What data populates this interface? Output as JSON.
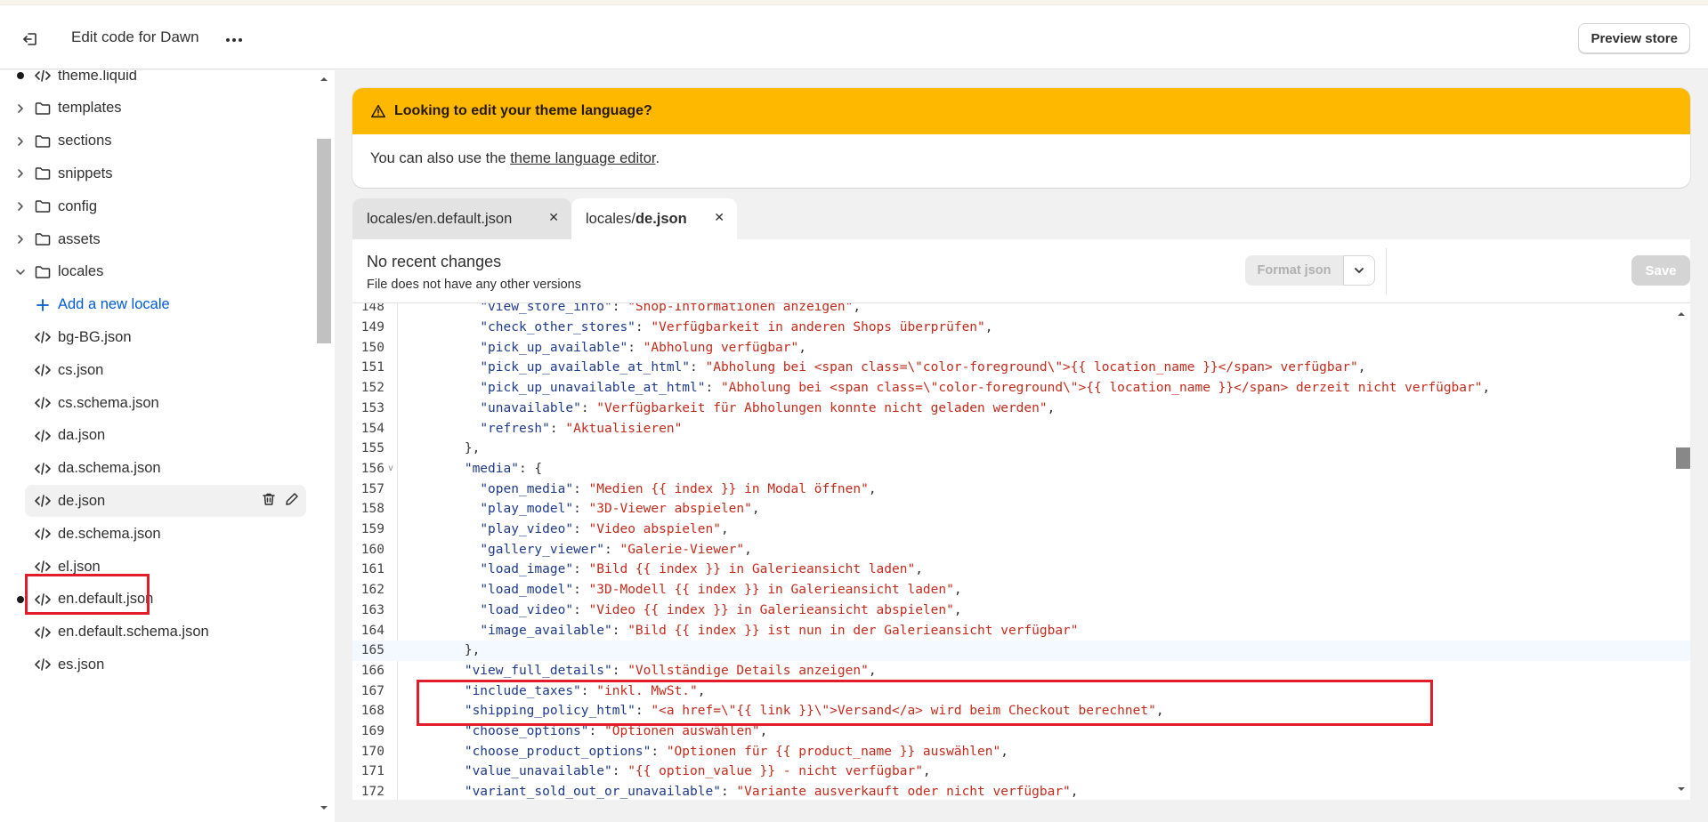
{
  "header": {
    "title": "Edit code for Dawn",
    "preview_label": "Preview store"
  },
  "sidebar": {
    "items": [
      {
        "label": "theme.liquid",
        "kind": "file",
        "dot": true
      },
      {
        "label": "templates",
        "kind": "folder"
      },
      {
        "label": "sections",
        "kind": "folder"
      },
      {
        "label": "snippets",
        "kind": "folder"
      },
      {
        "label": "config",
        "kind": "folder"
      },
      {
        "label": "assets",
        "kind": "folder"
      },
      {
        "label": "locales",
        "kind": "folder-open"
      },
      {
        "label": "Add a new locale",
        "kind": "add"
      },
      {
        "label": "bg-BG.json",
        "kind": "file"
      },
      {
        "label": "cs.json",
        "kind": "file"
      },
      {
        "label": "cs.schema.json",
        "kind": "file"
      },
      {
        "label": "da.json",
        "kind": "file"
      },
      {
        "label": "da.schema.json",
        "kind": "file"
      },
      {
        "label": "de.json",
        "kind": "file",
        "selected": true
      },
      {
        "label": "de.schema.json",
        "kind": "file"
      },
      {
        "label": "el.json",
        "kind": "file"
      },
      {
        "label": "en.default.json",
        "kind": "file",
        "dot": true
      },
      {
        "label": "en.default.schema.json",
        "kind": "file"
      },
      {
        "label": "es.json",
        "kind": "file"
      }
    ]
  },
  "banner": {
    "title": "Looking to edit your theme language?",
    "body_prefix": "You can also use the ",
    "link": "theme language editor",
    "body_suffix": "."
  },
  "tabs": [
    {
      "prefix": "locales/en.default.json",
      "bold": "",
      "active": false
    },
    {
      "prefix": "locales/",
      "bold": "de.json",
      "active": true
    }
  ],
  "editor": {
    "status_title": "No recent changes",
    "status_sub": "File does not have any other versions",
    "format_label": "Format json",
    "save_label": "Save"
  },
  "code_lines": [
    {
      "n": "148",
      "t": [
        [
          "p",
          "          "
        ],
        [
          "k",
          "\"view_store_info\""
        ],
        [
          "p",
          ": "
        ],
        [
          "s",
          "\"Shop-Informationen anzeigen\""
        ],
        [
          "p",
          ","
        ]
      ]
    },
    {
      "n": "149",
      "t": [
        [
          "p",
          "          "
        ],
        [
          "k",
          "\"check_other_stores\""
        ],
        [
          "p",
          ": "
        ],
        [
          "s",
          "\"Verfügbarkeit in anderen Shops überprüfen\""
        ],
        [
          "p",
          ","
        ]
      ]
    },
    {
      "n": "150",
      "t": [
        [
          "p",
          "          "
        ],
        [
          "k",
          "\"pick_up_available\""
        ],
        [
          "p",
          ": "
        ],
        [
          "s",
          "\"Abholung verfügbar\""
        ],
        [
          "p",
          ","
        ]
      ]
    },
    {
      "n": "151",
      "t": [
        [
          "p",
          "          "
        ],
        [
          "k",
          "\"pick_up_available_at_html\""
        ],
        [
          "p",
          ": "
        ],
        [
          "s",
          "\"Abholung bei <span class=\\\"color-foreground\\\">{{ location_name }}</span> verfügbar\""
        ],
        [
          "p",
          ","
        ]
      ]
    },
    {
      "n": "152",
      "t": [
        [
          "p",
          "          "
        ],
        [
          "k",
          "\"pick_up_unavailable_at_html\""
        ],
        [
          "p",
          ": "
        ],
        [
          "s",
          "\"Abholung bei <span class=\\\"color-foreground\\\">{{ location_name }}</span> derzeit nicht verfügbar\""
        ],
        [
          "p",
          ","
        ]
      ]
    },
    {
      "n": "153",
      "t": [
        [
          "p",
          "          "
        ],
        [
          "k",
          "\"unavailable\""
        ],
        [
          "p",
          ": "
        ],
        [
          "s",
          "\"Verfügbarkeit für Abholungen konnte nicht geladen werden\""
        ],
        [
          "p",
          ","
        ]
      ]
    },
    {
      "n": "154",
      "t": [
        [
          "p",
          "          "
        ],
        [
          "k",
          "\"refresh\""
        ],
        [
          "p",
          ": "
        ],
        [
          "s",
          "\"Aktualisieren\""
        ]
      ]
    },
    {
      "n": "155",
      "t": [
        [
          "p",
          "        },"
        ]
      ]
    },
    {
      "n": "156",
      "fold": true,
      "t": [
        [
          "p",
          "        "
        ],
        [
          "k",
          "\"media\""
        ],
        [
          "p",
          ": {"
        ]
      ]
    },
    {
      "n": "157",
      "t": [
        [
          "p",
          "          "
        ],
        [
          "k",
          "\"open_media\""
        ],
        [
          "p",
          ": "
        ],
        [
          "s",
          "\"Medien {{ index }} in Modal öffnen\""
        ],
        [
          "p",
          ","
        ]
      ]
    },
    {
      "n": "158",
      "t": [
        [
          "p",
          "          "
        ],
        [
          "k",
          "\"play_model\""
        ],
        [
          "p",
          ": "
        ],
        [
          "s",
          "\"3D-Viewer abspielen\""
        ],
        [
          "p",
          ","
        ]
      ]
    },
    {
      "n": "159",
      "t": [
        [
          "p",
          "          "
        ],
        [
          "k",
          "\"play_video\""
        ],
        [
          "p",
          ": "
        ],
        [
          "s",
          "\"Video abspielen\""
        ],
        [
          "p",
          ","
        ]
      ]
    },
    {
      "n": "160",
      "t": [
        [
          "p",
          "          "
        ],
        [
          "k",
          "\"gallery_viewer\""
        ],
        [
          "p",
          ": "
        ],
        [
          "s",
          "\"Galerie-Viewer\""
        ],
        [
          "p",
          ","
        ]
      ]
    },
    {
      "n": "161",
      "t": [
        [
          "p",
          "          "
        ],
        [
          "k",
          "\"load_image\""
        ],
        [
          "p",
          ": "
        ],
        [
          "s",
          "\"Bild {{ index }} in Galerieansicht laden\""
        ],
        [
          "p",
          ","
        ]
      ]
    },
    {
      "n": "162",
      "t": [
        [
          "p",
          "          "
        ],
        [
          "k",
          "\"load_model\""
        ],
        [
          "p",
          ": "
        ],
        [
          "s",
          "\"3D-Modell {{ index }} in Galerieansicht laden\""
        ],
        [
          "p",
          ","
        ]
      ]
    },
    {
      "n": "163",
      "t": [
        [
          "p",
          "          "
        ],
        [
          "k",
          "\"load_video\""
        ],
        [
          "p",
          ": "
        ],
        [
          "s",
          "\"Video {{ index }} in Galerieansicht abspielen\""
        ],
        [
          "p",
          ","
        ]
      ]
    },
    {
      "n": "164",
      "t": [
        [
          "p",
          "          "
        ],
        [
          "k",
          "\"image_available\""
        ],
        [
          "p",
          ": "
        ],
        [
          "s",
          "\"Bild {{ index }} ist nun in der Galerieansicht verfügbar\""
        ]
      ]
    },
    {
      "n": "165",
      "hl": true,
      "t": [
        [
          "p",
          "        },"
        ]
      ]
    },
    {
      "n": "166",
      "t": [
        [
          "p",
          "        "
        ],
        [
          "k",
          "\"view_full_details\""
        ],
        [
          "p",
          ": "
        ],
        [
          "s",
          "\"Vollständige Details anzeigen\""
        ],
        [
          "p",
          ","
        ]
      ]
    },
    {
      "n": "167",
      "t": [
        [
          "p",
          "        "
        ],
        [
          "k",
          "\"include_taxes\""
        ],
        [
          "p",
          ": "
        ],
        [
          "s",
          "\"inkl. MwSt.\""
        ],
        [
          "p",
          ","
        ]
      ]
    },
    {
      "n": "168",
      "t": [
        [
          "p",
          "        "
        ],
        [
          "k",
          "\"shipping_policy_html\""
        ],
        [
          "p",
          ": "
        ],
        [
          "s",
          "\"<a href=\\\"{{ link }}\\\">Versand</a> wird beim Checkout berechnet\""
        ],
        [
          "p",
          ","
        ]
      ]
    },
    {
      "n": "169",
      "t": [
        [
          "p",
          "        "
        ],
        [
          "k",
          "\"choose_options\""
        ],
        [
          "p",
          ": "
        ],
        [
          "s",
          "\"Optionen auswählen\""
        ],
        [
          "p",
          ","
        ]
      ]
    },
    {
      "n": "170",
      "t": [
        [
          "p",
          "        "
        ],
        [
          "k",
          "\"choose_product_options\""
        ],
        [
          "p",
          ": "
        ],
        [
          "s",
          "\"Optionen für {{ product_name }} auswählen\""
        ],
        [
          "p",
          ","
        ]
      ]
    },
    {
      "n": "171",
      "t": [
        [
          "p",
          "        "
        ],
        [
          "k",
          "\"value_unavailable\""
        ],
        [
          "p",
          ": "
        ],
        [
          "s",
          "\"{{ option_value }} - nicht verfügbar\""
        ],
        [
          "p",
          ","
        ]
      ]
    },
    {
      "n": "172",
      "t": [
        [
          "p",
          "        "
        ],
        [
          "k",
          "\"variant_sold_out_or_unavailable\""
        ],
        [
          "p",
          ": "
        ],
        [
          "s",
          "\"Variante ausverkauft oder nicht verfügbar\""
        ],
        [
          "p",
          ","
        ]
      ]
    }
  ],
  "colors": {
    "banner_warning": "#ffb800",
    "highlight_box": "#e11d2b",
    "link": "#005bd3",
    "json_key": "#1e3a8a",
    "json_string": "#c42b1c"
  }
}
